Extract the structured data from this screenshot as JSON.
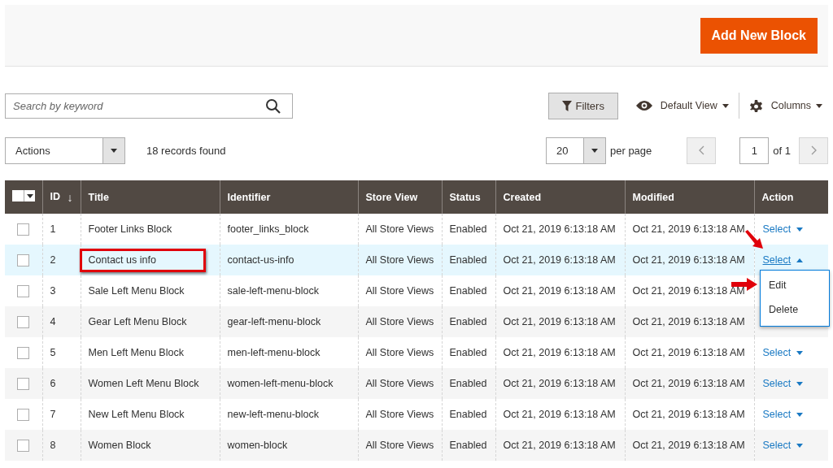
{
  "header": {
    "add_button": "Add New Block"
  },
  "search": {
    "placeholder": "Search by keyword"
  },
  "toolbar": {
    "filters": "Filters",
    "view": "Default View",
    "columns": "Columns"
  },
  "actions": {
    "label": "Actions"
  },
  "records": "18 records found",
  "pager": {
    "per_page_value": "20",
    "per_page_label": "per page",
    "page": "1",
    "of": "of 1"
  },
  "table": {
    "columns": [
      "ID",
      "Title",
      "Identifier",
      "Store View",
      "Status",
      "Created",
      "Modified",
      "Action"
    ],
    "sort_mark": "↓",
    "rows": [
      {
        "checked": false,
        "selected": false,
        "highlighted": false,
        "cells": [
          "1",
          "Footer Links Block",
          "footer_links_block",
          "All Store Views",
          "Enabled",
          "Oct 21, 2019 6:13:18 AM",
          "Oct 21, 2019 6:13:18 AM"
        ],
        "action": "Select",
        "expanded": false
      },
      {
        "checked": false,
        "selected": true,
        "highlighted": true,
        "cells": [
          "2",
          "Contact us info",
          "contact-us-info",
          "All Store Views",
          "Enabled",
          "Oct 21, 2019 6:13:18 AM",
          "Oct 21, 2019 6:13:18 AM"
        ],
        "action": "Select",
        "expanded": true,
        "menu": [
          "Edit",
          "Delete"
        ]
      },
      {
        "checked": false,
        "selected": false,
        "highlighted": false,
        "cells": [
          "3",
          "Sale Left Menu Block",
          "sale-left-menu-block",
          "All Store Views",
          "Enabled",
          "Oct 21, 2019 6:13:18 AM",
          "Oct 21, 2019 6:13:18 AM"
        ]
      },
      {
        "checked": false,
        "selected": false,
        "highlighted": false,
        "cells": [
          "4",
          "Gear Left Menu Block",
          "gear-left-menu-block",
          "All Store Views",
          "Enabled",
          "Oct 21, 2019 6:13:18 AM",
          "Oct 21, 2019 6:13:18 AM"
        ]
      },
      {
        "checked": false,
        "selected": false,
        "highlighted": false,
        "cells": [
          "5",
          "Men Left Menu Block",
          "men-left-menu-block",
          "All Store Views",
          "Enabled",
          "Oct 21, 2019 6:13:18 AM",
          "Oct 21, 2019 6:13:18 AM"
        ],
        "action": "Select",
        "expanded": false
      },
      {
        "checked": false,
        "selected": false,
        "highlighted": false,
        "cells": [
          "6",
          "Women Left Menu Block",
          "women-left-menu-block",
          "All Store Views",
          "Enabled",
          "Oct 21, 2019 6:13:18 AM",
          "Oct 21, 2019 6:13:18 AM"
        ],
        "action": "Select",
        "expanded": false
      },
      {
        "checked": false,
        "selected": false,
        "highlighted": false,
        "cells": [
          "7",
          "New Left Menu Block",
          "new-left-menu-block",
          "All Store Views",
          "Enabled",
          "Oct 21, 2019 6:13:18 AM",
          "Oct 21, 2019 6:13:18 AM"
        ],
        "action": "Select",
        "expanded": false
      },
      {
        "checked": false,
        "selected": false,
        "highlighted": false,
        "cells": [
          "8",
          "Women Block",
          "women-block",
          "All Store Views",
          "Enabled",
          "Oct 21, 2019 6:13:18 AM",
          "Oct 21, 2019 6:13:18 AM"
        ],
        "action": "Select",
        "expanded": false
      }
    ]
  }
}
